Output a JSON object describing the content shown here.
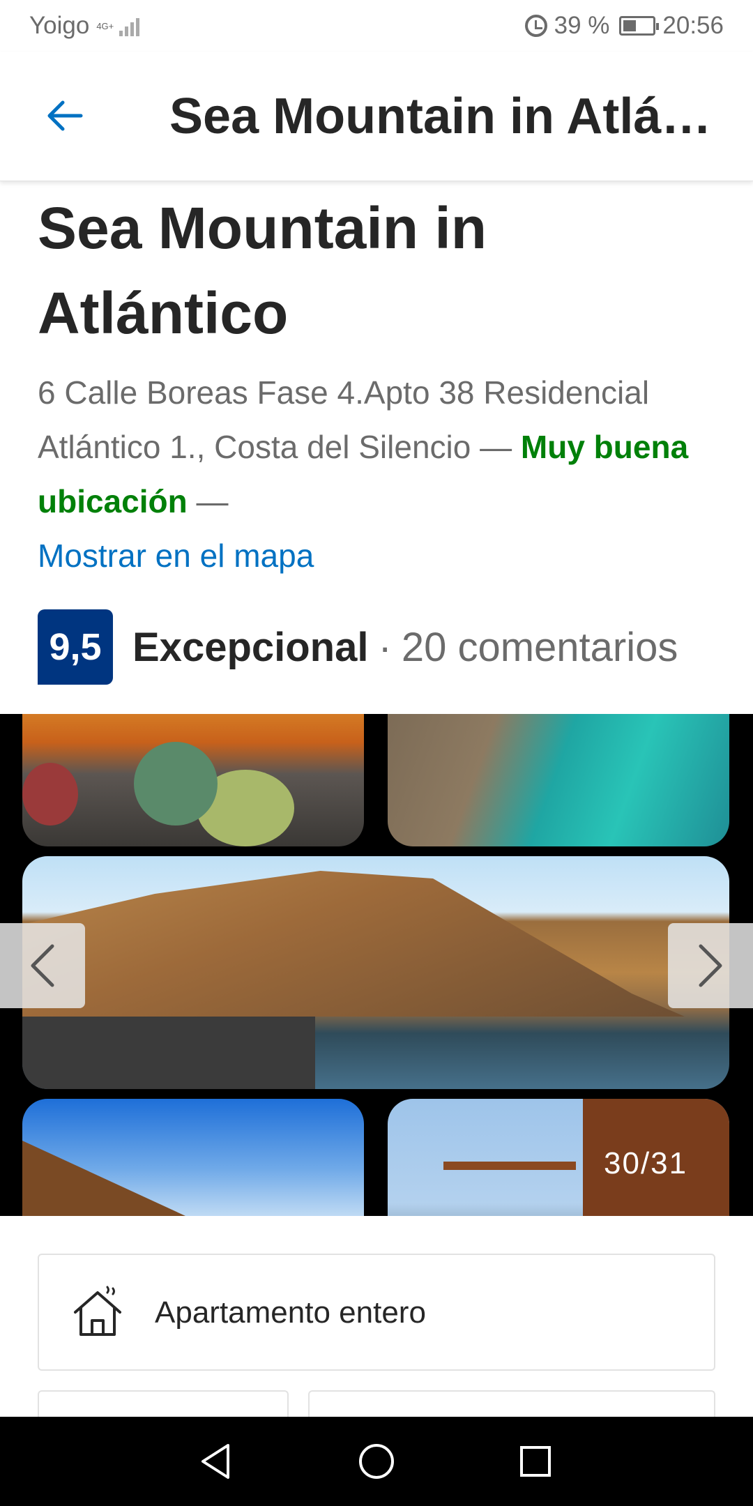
{
  "status_bar": {
    "carrier": "Yoigo",
    "network": "4G+",
    "battery_percent": "39 %",
    "time": "20:56",
    "alarm_icon": "alarm-icon",
    "battery_icon": "battery-icon"
  },
  "app_bar": {
    "title": "Sea Mountain in Atlá…",
    "back_icon": "back-arrow-icon"
  },
  "property": {
    "name": "Sea Mountain in Atlántico",
    "address": "6 Calle Boreas Fase 4.Apto 38 Residencial Atlántico 1., Costa del Silencio",
    "separator_1": " — ",
    "location_badge": "Muy buena ubicación",
    "separator_2": " —",
    "map_link": "Mostrar en el mapa"
  },
  "rating": {
    "score": "9,5",
    "label": "Excepcional",
    "separator": "·",
    "reviews": "20 comentarios"
  },
  "gallery": {
    "counter": "30/31",
    "current": 30,
    "total": 31,
    "prev_icon": "chevron-left-icon",
    "next_icon": "chevron-right-icon"
  },
  "unit": {
    "label": "Apartamento entero",
    "icon": "house-icon"
  },
  "colors": {
    "brand_blue": "#003580",
    "link_blue": "#0071c2",
    "location_green": "#008009",
    "text_dark": "#262626",
    "text_grey": "#6b6b6b"
  }
}
